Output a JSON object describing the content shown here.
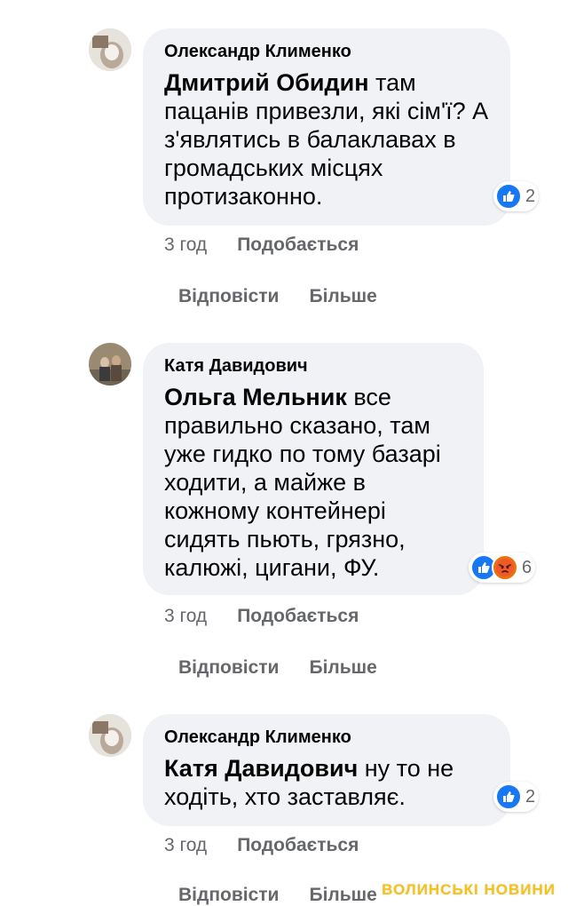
{
  "comments": [
    {
      "author": "Олександр Клименко",
      "mention": "Дмитрий Обидин",
      "text": " там пацанів привезли, які сім'ї? А з'являтись в балаклавах в громадських місцях протизаконно.",
      "reaction_count": "2",
      "reactions": [
        "like-icon"
      ],
      "time": "3 год",
      "like_label": "Подобається",
      "reply_label": "Відповісти",
      "more_label": "Більше"
    },
    {
      "author": "Катя Давидович",
      "mention": "Ольга Мельник",
      "text": " все правильно сказано, там уже гидко по тому базарі ходити, а майже в кожному контейнері сидять пьють, грязно, калюжі, цигани, ФУ.",
      "reaction_count": "6",
      "reactions": [
        "like-icon",
        "angry-icon"
      ],
      "time": "3 год",
      "like_label": "Подобається",
      "reply_label": "Відповісти",
      "more_label": "Більше"
    },
    {
      "author": "Олександр Клименко",
      "mention": "Катя Давидович",
      "text": " ну то не ходіть, хто заставляє.",
      "reaction_count": "2",
      "reactions": [
        "like-icon"
      ],
      "time": "3 год",
      "like_label": "Подобається",
      "reply_label": "Відповісти",
      "more_label": "Більше"
    }
  ],
  "watermark": "ВОЛИНСЬКІ НОВИНИ",
  "colors": {
    "bubble": "#f0f2f5",
    "meta_text": "#65676b",
    "like_blue": "#1877f2",
    "angry_orange": "#e9710f",
    "watermark": "#f3c317"
  }
}
